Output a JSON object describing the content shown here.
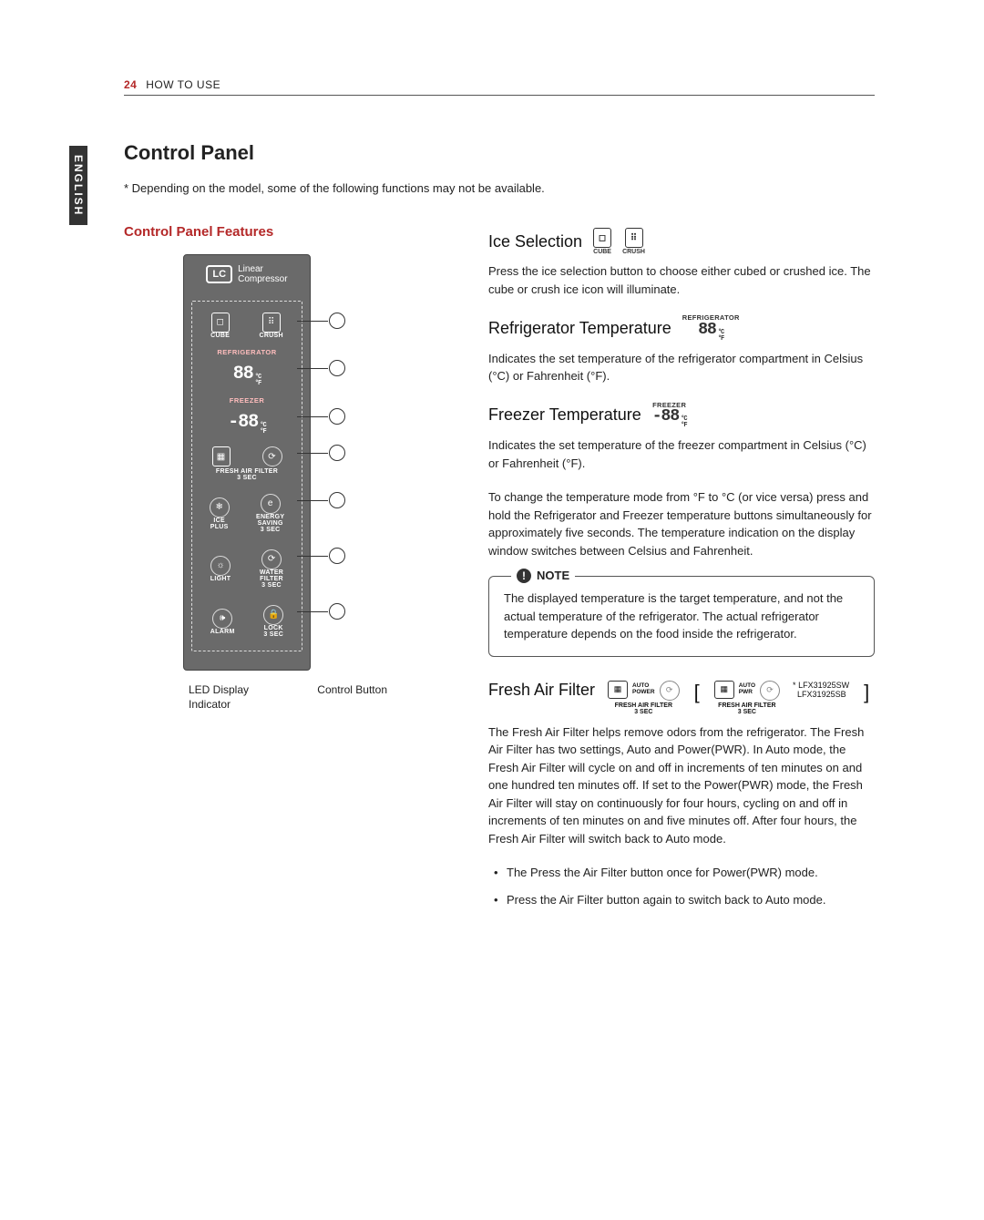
{
  "header": {
    "page_num": "24",
    "section": "HOW TO USE"
  },
  "side_tab": "ENGLISH",
  "title": "Control Panel",
  "subtitle": "* Depending on the model, some of the following functions may not be available.",
  "left": {
    "heading": "Control Panel Features",
    "lc_badge": "LC",
    "lc_text": "Linear\nCompressor",
    "labels": {
      "cube": "CUBE",
      "crush": "CRUSH",
      "refrigerator": "REFRIGERATOR",
      "freezer": "FREEZER",
      "fresh_air": "FRESH AIR FILTER",
      "sec3_a": "3 SEC",
      "ice_plus": "ICE\nPLUS",
      "energy": "ENERGY\nSAVING",
      "sec3_b": "3 SEC",
      "light": "LIGHT",
      "water_filter": "WATER\nFILTER",
      "sec3_c": "3 SEC",
      "alarm": "ALARM",
      "lock": "LOCK",
      "sec3_d": "3 SEC"
    },
    "seg_fridge": "88",
    "seg_freezer": "-88",
    "unit_c": "°C",
    "unit_f": "°F",
    "caption_left": "LED Display Indicator",
    "caption_right": "Control Button"
  },
  "right": {
    "ice": {
      "title": "Ice Selection",
      "cube": "CUBE",
      "crush": "CRUSH",
      "body": "Press the ice selection button to choose either cubed or crushed ice. The cube or crush ice icon will illuminate."
    },
    "fridge": {
      "title": "Refrigerator Temperature",
      "caption": "REFRIGERATOR",
      "seg": "88",
      "uc": "°C",
      "uf": "°F",
      "body": "Indicates the set temperature of the refrigerator compartment in Celsius (°C) or Fahrenheit (°F)."
    },
    "freezer": {
      "title": "Freezer Temperature",
      "caption": "FREEZER",
      "seg": "-88",
      "uc": "°C",
      "uf": "°F",
      "body1": "Indicates the set temperature of the freezer compartment in Celsius (°C) or Fahrenheit (°F).",
      "body2": "To change the temperature mode from °F to °C (or vice versa) press and hold the Refrigerator and Freezer temperature buttons simultaneously for approximately five seconds. The temperature indication on the display window switches between Celsius and Fahrenheit."
    },
    "note": {
      "label": "NOTE",
      "body": "The displayed temperature is the target temperature, and not the actual temperature of the refrigerator. The actual refrigerator temperature depends on the food inside the refrigerator."
    },
    "faf": {
      "title": "Fresh Air Filter",
      "mode_auto": "AUTO",
      "mode_power": "POWER",
      "mode_pwr": "PWR",
      "caption": "FRESH AIR FILTER",
      "sec": "3 SEC",
      "models_note": "*",
      "model1": "LFX31925SW",
      "model2": "LFX31925SB",
      "body": "The Fresh Air Filter helps remove odors from the refrigerator. The Fresh Air Filter has two settings, Auto and Power(PWR). In Auto mode, the Fresh Air Filter will cycle on and off in increments of ten minutes on and one hundred ten minutes off. If set to the Power(PWR) mode, the Fresh Air Filter will stay on continuously for four hours, cycling on and off in increments of ten minutes on and five minutes off. After four hours, the Fresh Air Filter will switch back to Auto mode.",
      "bullet1": "The Press the Air Filter button once for Power(PWR) mode.",
      "bullet2": "Press the Air Filter button again to switch back to Auto mode."
    }
  }
}
